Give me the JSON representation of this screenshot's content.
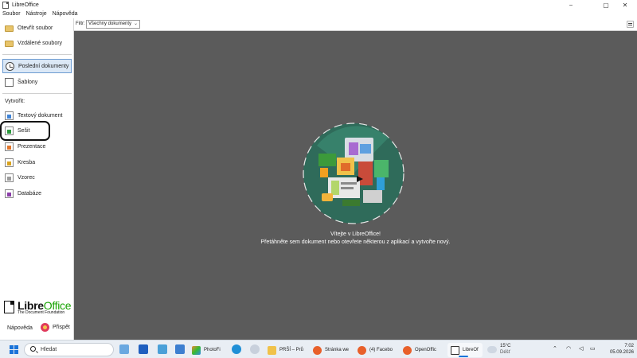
{
  "window": {
    "title": "LibreOffice",
    "minimize_glyph": "−",
    "maximize_glyph": "▢",
    "close_glyph": "✕"
  },
  "menubar": {
    "items": [
      "Soubor",
      "Nástroje",
      "Nápověda"
    ]
  },
  "sidebar": {
    "open_file": "Otevřít soubor",
    "remote_files": "Vzdálené soubory",
    "recent_documents": "Poslední dokumenty",
    "templates": "Šablony",
    "create_heading": "Vytvořit:",
    "create_items": [
      "Textový dokument",
      "Sešit",
      "Prezentace",
      "Kresba",
      "Vzorec",
      "Databáze"
    ],
    "logo_name": "Libre",
    "logo_name_office": "Office",
    "logo_sub": "The Document Foundation",
    "help": "Nápověda",
    "donate": "Přispět",
    "active_item": "recent_documents",
    "highlighted_item": "Sešit"
  },
  "filter": {
    "label": "Filtr:",
    "value": "Všechny dokumenty"
  },
  "main": {
    "welcome_title": "Vítejte v LibreOffice!",
    "welcome_subtitle": "Přetáhněte sem dokument nebo otevřete některou z aplikací a vytvořte nový."
  },
  "taskbar": {
    "search_placeholder": "Hledat",
    "apps": [
      {
        "label": "PhotoFi",
        "icon": "photofiltre-icon"
      },
      {
        "label": "PRŠÍ – Prů",
        "icon": "folder-icon"
      },
      {
        "label": "Stránka we",
        "icon": "firefox-icon"
      },
      {
        "label": "(4) Facebo",
        "icon": "firefox-icon"
      },
      {
        "label": "OpenOffic",
        "icon": "firefox-icon"
      },
      {
        "label": "LibreOf",
        "icon": "libreoffice-icon"
      }
    ],
    "weather_temp": "15°C",
    "weather_text": "Déšť",
    "time": "7:02",
    "date": "05.09.2026"
  },
  "colors": {
    "main_background": "#5b5b5b",
    "sidebar_active": "#dbe8f6",
    "logo_green": "#18a303",
    "taskbar": "#e9eef4"
  }
}
